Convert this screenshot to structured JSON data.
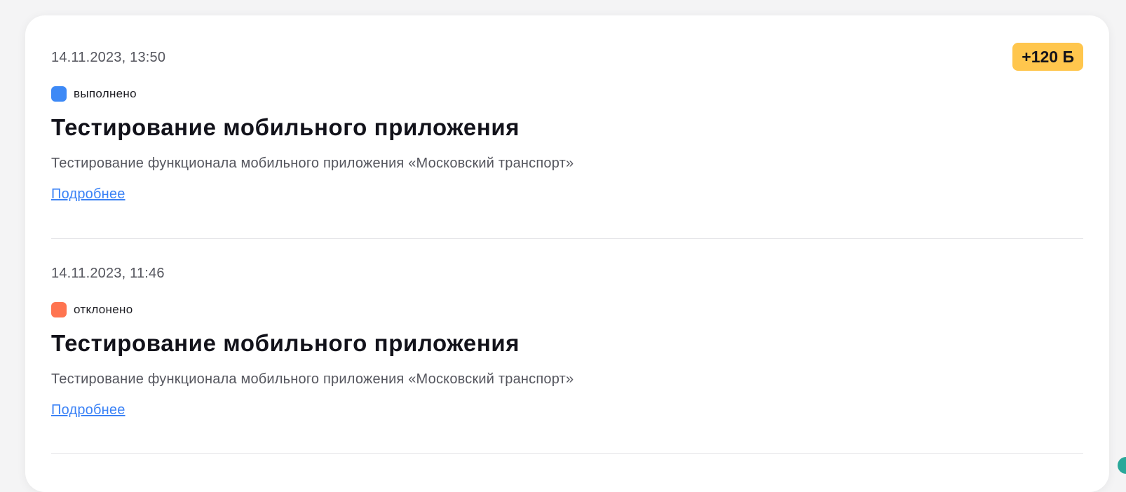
{
  "entries": [
    {
      "date": "14.11.2023, 13:50",
      "badge": "+120 Б",
      "status": {
        "label": "выполнено",
        "color": "#3d89f6"
      },
      "title": "Тестирование мобильного приложения",
      "description": "Тестирование функционала мобильного приложения «Московский транспорт»",
      "link_label": "Подробнее"
    },
    {
      "date": "14.11.2023, 11:46",
      "status": {
        "label": "отклонено",
        "color": "#ff7450"
      },
      "title": "Тестирование мобильного приложения",
      "description": "Тестирование функционала мобильного приложения «Московский транспорт»",
      "link_label": "Подробнее"
    }
  ],
  "colors": {
    "badge_bg": "#ffc64d",
    "link": "#3b82f6",
    "corner_accent": "#2aa89a"
  }
}
